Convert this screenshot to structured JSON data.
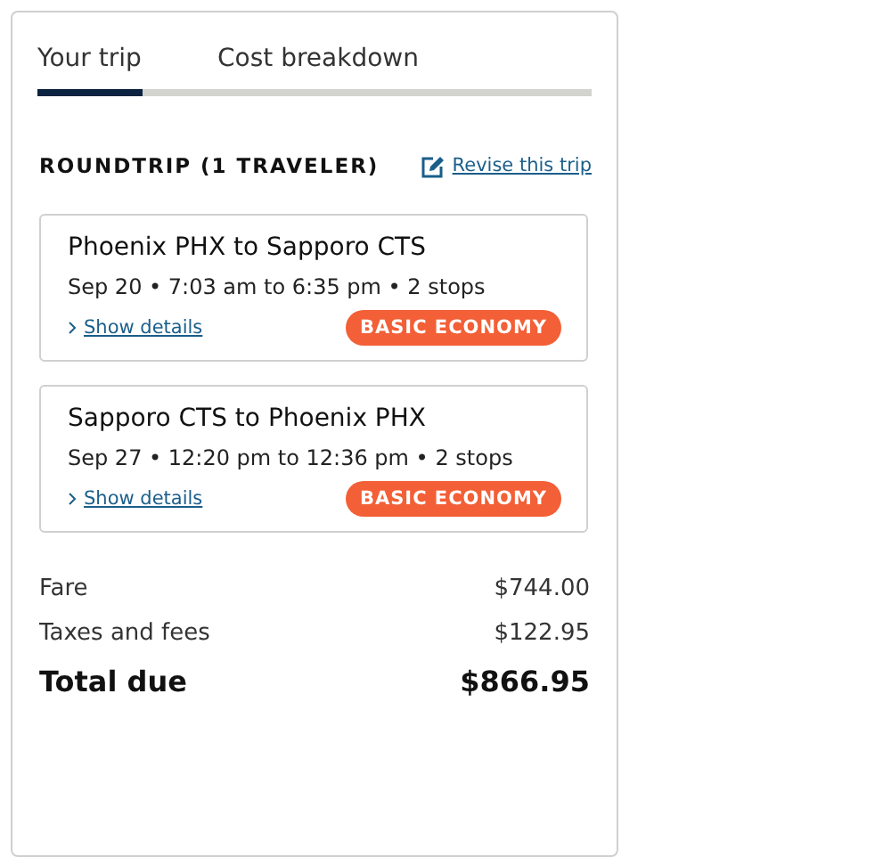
{
  "tabs": [
    {
      "label": "Your trip",
      "selected": true
    },
    {
      "label": "Cost breakdown",
      "selected": false
    }
  ],
  "heading": "ROUNDTRIP (1 TRAVELER)",
  "revise_link": "Revise this trip",
  "legs": [
    {
      "route": "Phoenix PHX to Sapporo CTS",
      "schedule": "Sep 20 • 7:03 am to 6:35 pm • 2 stops",
      "details_link": "Show details",
      "fare_class": "BASIC ECONOMY"
    },
    {
      "route": "Sapporo CTS to Phoenix PHX",
      "schedule": "Sep 27 • 12:20 pm to 12:36 pm • 2 stops",
      "details_link": "Show details",
      "fare_class": "BASIC ECONOMY"
    }
  ],
  "costs": [
    {
      "label": "Fare",
      "amount": "$744.00",
      "kind": "line"
    },
    {
      "label": "Taxes and fees",
      "amount": "$122.95",
      "kind": "line"
    },
    {
      "label": "Total due",
      "amount": "$866.95",
      "kind": "total"
    }
  ]
}
